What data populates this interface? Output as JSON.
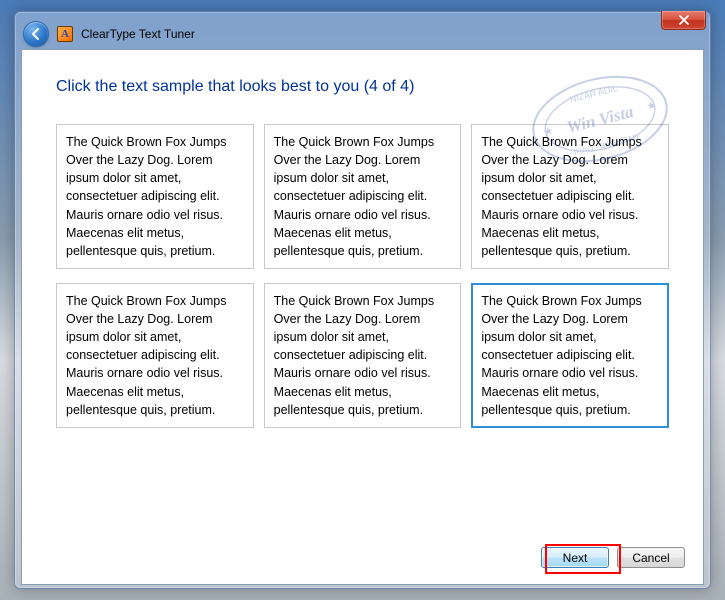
{
  "header": {
    "title": "ClearType Text Tuner",
    "icon_letter": "A"
  },
  "instruction": "Click the text sample that looks best to you (4 of 4)",
  "sample_text": "The Quick Brown Fox Jumps Over the Lazy Dog. Lorem ipsum dolor sit amet, consectetuer adipiscing elit. Mauris ornare odio vel risus. Maecenas elit metus, pellentesque quis, pretium.",
  "selected_index": 5,
  "buttons": {
    "next": "Next",
    "cancel": "Cancel"
  },
  "watermark": {
    "line1": "NIZAR ADIL",
    "line2": "Win Vista",
    "line3": "IRAQ - BAGHDAD"
  }
}
